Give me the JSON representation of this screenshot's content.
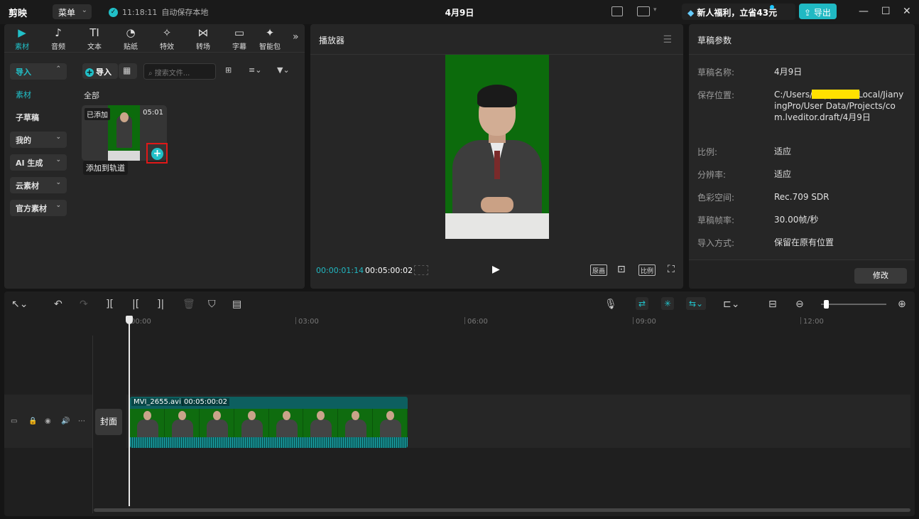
{
  "app": {
    "name": "剪映",
    "menu_label": "菜单",
    "autosave_time": "11:18:11",
    "autosave_text": "自动保存本地",
    "project_title": "4月9日",
    "promo_text": "新人福利，立省43元",
    "export_label": "导出"
  },
  "media_tabs": [
    {
      "label": "素材",
      "icon": "media-icon"
    },
    {
      "label": "音频",
      "icon": "audio-icon"
    },
    {
      "label": "文本",
      "icon": "text-icon"
    },
    {
      "label": "贴纸",
      "icon": "sticker-icon"
    },
    {
      "label": "特效",
      "icon": "effects-icon"
    },
    {
      "label": "转场",
      "icon": "transition-icon"
    },
    {
      "label": "字幕",
      "icon": "subtitle-icon"
    },
    {
      "label": "智能包",
      "icon": "smart-icon"
    }
  ],
  "sidebar": {
    "items": [
      {
        "label": "导入"
      },
      {
        "label": "素材"
      },
      {
        "label": "子草稿"
      },
      {
        "label": "我的"
      },
      {
        "label": "AI 生成"
      },
      {
        "label": "云素材"
      },
      {
        "label": "官方素材"
      }
    ]
  },
  "media_toolbar": {
    "import_label": "导入",
    "search_placeholder": "搜索文件..."
  },
  "media_section": {
    "title": "全部"
  },
  "media_item": {
    "added_badge": "已添加",
    "duration": "05:01",
    "tooltip": "添加到轨道"
  },
  "player": {
    "title": "播放器",
    "current_time": "00:00:01:14",
    "total_time": "00:05:00:02",
    "original_label": "原画",
    "ratio_label": "比例"
  },
  "draft_params": {
    "title": "草稿参数",
    "rows": [
      {
        "label": "草稿名称:",
        "value": "4月9日"
      },
      {
        "label": "保存位置:",
        "value": "C:/Users/          /AppData/Local/JianyingPro/User Data/Projects/com.lveditor.draft/4月9日"
      },
      {
        "label": "比例:",
        "value": "适应"
      },
      {
        "label": "分辨率:",
        "value": "适应"
      },
      {
        "label": "色彩空间:",
        "value": "Rec.709 SDR"
      },
      {
        "label": "草稿帧率:",
        "value": "30.00帧/秒"
      },
      {
        "label": "导入方式:",
        "value": "保留在原有位置"
      }
    ],
    "modify_label": "修改"
  },
  "timeline": {
    "ruler": [
      "00:00",
      "03:00",
      "06:00",
      "09:00",
      "12:00"
    ],
    "cover_label": "封面",
    "clip_name": "MVI_2655.avi",
    "clip_duration": "00:05:00:02"
  },
  "colors": {
    "accent": "#21c0c8",
    "highlight": "#ffe100",
    "annotation": "#e01818"
  }
}
